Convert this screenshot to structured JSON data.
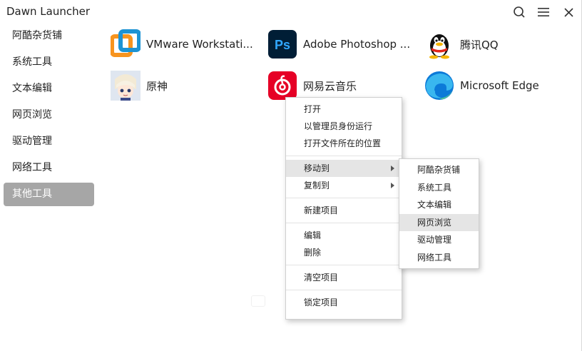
{
  "window": {
    "title": "Dawn Launcher"
  },
  "titlebar_icons": {
    "search": "search-icon",
    "menu": "hamburger-icon",
    "close": "close-icon"
  },
  "sidebar": {
    "items": [
      {
        "label": "阿酷杂货铺",
        "active": false
      },
      {
        "label": "系统工具",
        "active": false
      },
      {
        "label": "文本编辑",
        "active": false
      },
      {
        "label": "网页浏览",
        "active": false
      },
      {
        "label": "驱动管理",
        "active": false
      },
      {
        "label": "网络工具",
        "active": false
      },
      {
        "label": "其他工具",
        "active": true
      }
    ]
  },
  "apps": [
    {
      "label": "VMware Workstati...",
      "icon": "vmware-icon"
    },
    {
      "label": "Adobe Photoshop ...",
      "icon": "photoshop-icon"
    },
    {
      "label": "腾讯QQ",
      "icon": "qq-penguin-icon"
    },
    {
      "label": "原神",
      "icon": "genshin-character-icon"
    },
    {
      "label": "网易云音乐",
      "icon": "netease-music-icon"
    },
    {
      "label": "Microsoft Edge",
      "icon": "edge-icon"
    }
  ],
  "context_menu": {
    "open": "打开",
    "run_as_admin": "以管理员身份运行",
    "open_location": "打开文件所在的位置",
    "move_to": "移动到",
    "copy_to": "复制到",
    "new_item": "新建项目",
    "edit": "编辑",
    "delete": "删除",
    "clear_items": "清空项目",
    "lock_items": "锁定项目"
  },
  "submenu": {
    "items": [
      "阿酷杂货铺",
      "系统工具",
      "文本编辑",
      "网页浏览",
      "驱动管理",
      "网络工具"
    ],
    "highlighted": "网页浏览"
  },
  "colors": {
    "sidebar_active": "#a6a6a6",
    "menu_highlight": "#e5e5e5",
    "photoshop_bg": "#001e36",
    "photoshop_text": "#31a8ff",
    "netease_red": "#e60026",
    "vmware_orange": "#f7941e",
    "vmware_blue": "#1d93d3"
  }
}
